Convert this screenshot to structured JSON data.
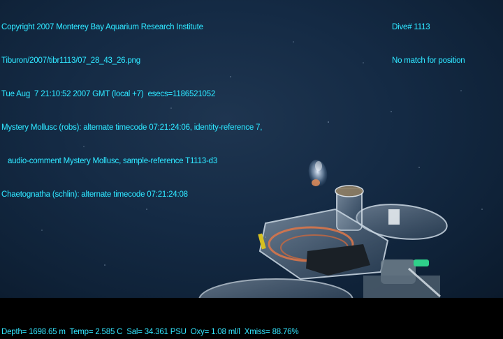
{
  "overlay": {
    "left_lines": [
      "Copyright 2007 Monterey Bay Aquarium Research Institute",
      "Tiburon/2007/tibr1113/07_28_43_26.png",
      "Tue Aug  7 21:10:52 2007 GMT (local +7)  esecs=1186521052",
      "Mystery Mollusc (robs): alternate timecode 07:21:24:06, identity-reference 7,",
      "   audio-comment Mystery Mollusc, sample-reference T1113-d3",
      "Chaetognatha (schlin): alternate timecode 07:21:24:08"
    ],
    "right_lines": [
      "Dive# 1113",
      "No match for position"
    ]
  },
  "footer": {
    "telemetry": "Depth= 1698.65 m  Temp= 2.585 C  Sal= 34.361 PSU  Oxy= 1.08 ml/l  Xmiss= 88.76%"
  }
}
